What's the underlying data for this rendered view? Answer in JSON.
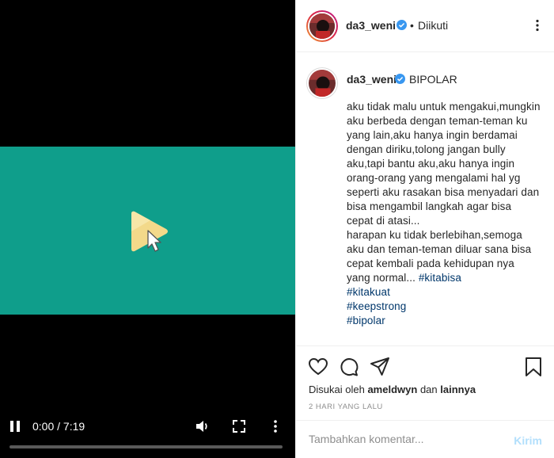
{
  "video": {
    "time": "0:00 / 7:19",
    "progress": 0,
    "frame_color": "#0f9e8b",
    "icons": [
      "pause-icon",
      "volume-icon",
      "fullscreen-icon",
      "more-vertical-icon"
    ]
  },
  "header": {
    "username": "da3_weni",
    "separator": "•",
    "follow_label": "Diikuti"
  },
  "caption": {
    "username": "da3_weni",
    "first_line": "BIPOLAR",
    "body": "aku tidak malu untuk mengakui,mungkin aku berbeda dengan teman-teman ku yang lain,aku hanya ingin berdamai dengan diriku,tolong jangan bully aku,tapi bantu aku,aku hanya ingin orang-orang yang mengalami hal yg seperti aku rasakan bisa menyadari dan bisa mengambil langkah agar bisa cepat di atasi...",
    "body2": "harapan ku tidak berlebihan,semoga aku dan teman-teman diluar sana bisa cepat kembali pada kehidupan nya yang normal...",
    "tags": [
      "#kitabisa",
      "#kitakuat",
      "#keepstrong",
      "#bipolar"
    ]
  },
  "likes": {
    "prefix": "Disukai oleh",
    "user": "ameldwyn",
    "connector": "dan",
    "others": "lainnya"
  },
  "date": "2 HARI YANG LALU",
  "comment": {
    "placeholder": "Tambahkan komentar...",
    "post_label": "Kirim"
  },
  "colors": {
    "link": "#00376b",
    "verified": "#3897f0",
    "post_disabled": "#b2dffc"
  }
}
